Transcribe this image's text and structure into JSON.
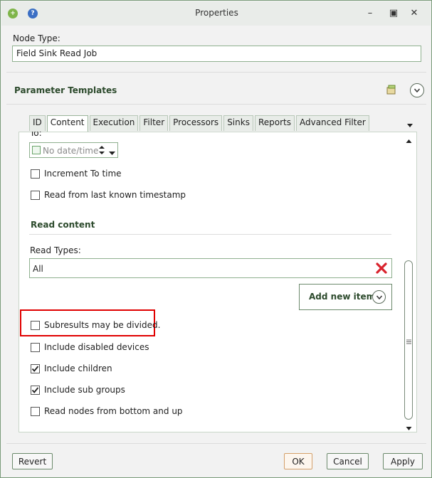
{
  "window": {
    "title": "Properties",
    "help_icon": "question-circle",
    "app_icon": "add-node",
    "minimize": "–",
    "restore": "▣",
    "close": "✕"
  },
  "node_type": {
    "label": "Node Type:",
    "value": "Field Sink Read Job"
  },
  "parameter_templates": {
    "title": "Parameter Templates"
  },
  "tabs": [
    {
      "label": "ID",
      "active": false
    },
    {
      "label": "Content",
      "active": true
    },
    {
      "label": "Execution",
      "active": false
    },
    {
      "label": "Filter",
      "active": false
    },
    {
      "label": "Processors",
      "active": false
    },
    {
      "label": "Sinks",
      "active": false
    },
    {
      "label": "Reports",
      "active": false
    },
    {
      "label": "Advanced Filter",
      "active": false
    }
  ],
  "content": {
    "to_label": "To:",
    "to_date_placeholder": "No date/time",
    "increment_to_time": {
      "label": "Increment To time",
      "checked": false
    },
    "read_from_last": {
      "label": "Read from last known timestamp",
      "checked": false
    },
    "read_content_title": "Read content",
    "read_types_label": "Read Types:",
    "read_types_value": "All",
    "add_new_items": "Add new items",
    "options": [
      {
        "label": "Subresults may be divided.",
        "checked": false
      },
      {
        "label": "Include disabled devices",
        "checked": false
      },
      {
        "label": "Include children",
        "checked": true
      },
      {
        "label": "Include sub groups",
        "checked": true
      },
      {
        "label": "Read nodes from bottom and up",
        "checked": false
      }
    ]
  },
  "footer": {
    "revert": "Revert",
    "ok": "OK",
    "cancel": "Cancel",
    "apply": "Apply"
  },
  "colors": {
    "accent_green": "#2c4a2c",
    "highlight_red": "#e00000",
    "delete_red": "#d9232d"
  }
}
